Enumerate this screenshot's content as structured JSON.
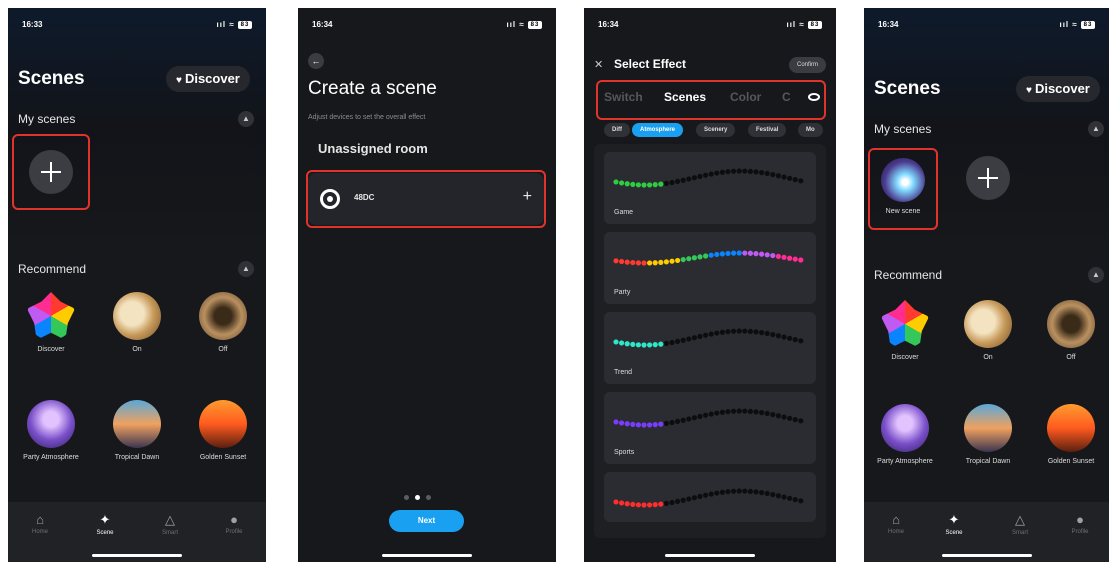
{
  "screens": [
    {
      "status": {
        "time": "16:33",
        "signal": "ııl ≈",
        "battery": "83"
      },
      "title": "Scenes",
      "discover_label": "Discover",
      "my_scenes_label": "My scenes",
      "recommend_label": "Recommend",
      "scenes": [
        {
          "label": "Discover",
          "icon": "discover-icon"
        },
        {
          "label": "On",
          "icon": "on-scene-icon"
        },
        {
          "label": "Off",
          "icon": "off-scene-icon"
        },
        {
          "label": "Party Atmosphere",
          "icon": "party-atmosphere-icon"
        },
        {
          "label": "Tropical Dawn",
          "icon": "tropical-dawn-icon"
        },
        {
          "label": "Golden Sunset",
          "icon": "golden-sunset-icon"
        }
      ],
      "tabs": [
        {
          "label": "Home",
          "icon": "home-icon"
        },
        {
          "label": "Scene",
          "icon": "scene-wand-icon"
        },
        {
          "label": "Smart",
          "icon": "smart-icon"
        },
        {
          "label": "Profile",
          "icon": "profile-icon"
        }
      ],
      "active_tab": "Scene"
    },
    {
      "status": {
        "time": "16:34",
        "signal": "ııl ≈",
        "battery": "83"
      },
      "title": "Create a scene",
      "subtitle": "Adjust devices to set the overall effect",
      "room_label": "Unassigned room",
      "device_name": "48DC",
      "next_label": "Next",
      "page_index": 2,
      "page_count": 3
    },
    {
      "status": {
        "time": "16:34",
        "signal": "ııl ≈",
        "battery": "83"
      },
      "title": "Select Effect",
      "confirm_label": "Confirm",
      "tabs": [
        "Switch",
        "Scenes",
        "Color",
        "C"
      ],
      "active_tab": "Scenes",
      "chips": [
        "Diff",
        "Atmosphere",
        "Scenery",
        "Festival",
        "Mo"
      ],
      "active_chip": "Atmosphere",
      "effects": [
        {
          "label": "Game",
          "colors": [
            "#2ecc40",
            "#1a1a1a"
          ]
        },
        {
          "label": "Party",
          "colors": [
            "#ff3b30",
            "#ffcc00",
            "#34c759",
            "#0a84ff",
            "#bf5af2",
            "#ff2d92"
          ]
        },
        {
          "label": "Trend",
          "colors": [
            "#2ee6c8",
            "#1a1a1a"
          ]
        },
        {
          "label": "Sports",
          "colors": [
            "#7a3cff",
            "#1a1a1a"
          ]
        },
        {
          "label": "",
          "colors": [
            "#ff2d2d",
            "#1a1a1a"
          ]
        }
      ]
    },
    {
      "status": {
        "time": "16:34",
        "signal": "ııl ≈",
        "battery": "83"
      },
      "title": "Scenes",
      "discover_label": "Discover",
      "my_scenes_label": "My scenes",
      "new_scene_label": "New scene",
      "recommend_label": "Recommend",
      "scenes": [
        {
          "label": "Discover"
        },
        {
          "label": "On"
        },
        {
          "label": "Off"
        },
        {
          "label": "Party Atmosphere"
        },
        {
          "label": "Tropical Dawn"
        },
        {
          "label": "Golden Sunset"
        }
      ],
      "tabs": [
        {
          "label": "Home"
        },
        {
          "label": "Scene"
        },
        {
          "label": "Smart"
        },
        {
          "label": "Profile"
        }
      ],
      "active_tab": "Scene"
    }
  ],
  "colors": {
    "background": "#17181b",
    "accent_blue": "#1aa0f0",
    "highlight_red": "#e0332c"
  }
}
